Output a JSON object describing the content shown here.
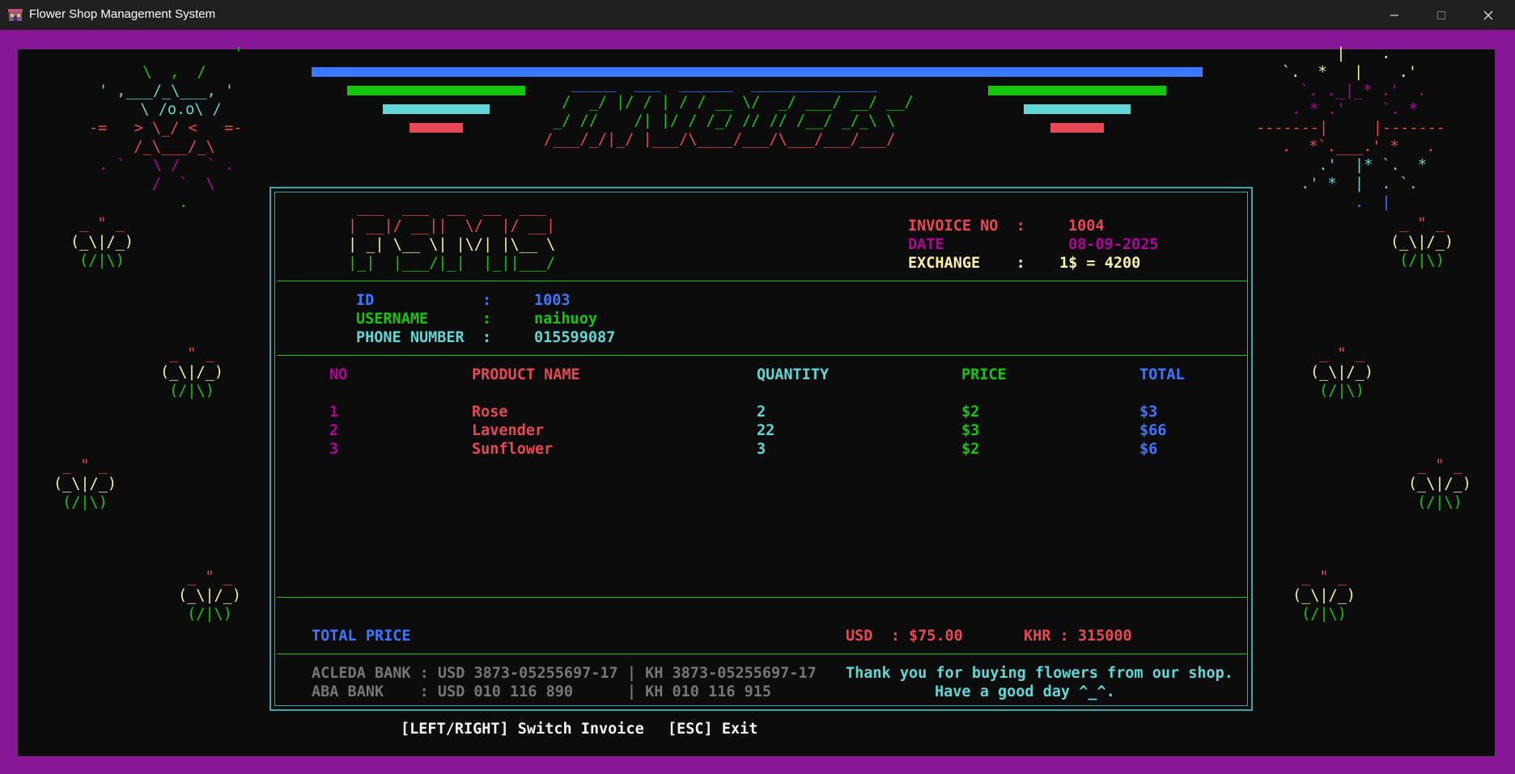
{
  "window": {
    "title": "Flower Shop Management System"
  },
  "art": {
    "fireworks_left": [
      "        '",
      "    \\  ,  /",
      "' ,___/_\\___, '",
      "   \\ /o.o\\ /",
      "-=   > \\_/ <   =-",
      "   /_\\___/_\\",
      ". `   \\ /   ` .",
      "     /  `  \\",
      "        ."
    ],
    "fireworks_right": [
      "          |    .",
      "`.  *   |    .'",
      "  `. ._|_* .'  .",
      ". * .'    `. *",
      "-------|     |-------",
      ".  *`.___.' *   .",
      "   .'  |* `.  *",
      " .' *  |  . `.",
      "       .  |"
    ],
    "flower": [
      " _ \" _",
      "(_\\|/_)",
      " (/|\\)"
    ],
    "invoice_banner": [
      "   _____  ___  ______  ______________",
      "  /  _/ |/ / | / / __ \\/  _/ ___/ __/ __/",
      " _/ //    /| |/ / /_/ // // /__/ _/_\\ \\",
      "/___/_/|_/ |___/\\____/___/\\___/___/___/"
    ],
    "fsms_logo": [
      " ___  ___  __  __  ___",
      "| __|/ __||  \\/  |/ __|",
      "| _| \\__ \\| |\\/| |\\__ \\",
      "|_|  |___/|_|  |_||___/"
    ]
  },
  "invoice": {
    "no_label": "INVOICE NO  :",
    "no_value": "1004",
    "date_label": "DATE",
    "date_value": "08-09-2025",
    "exchange_label": "EXCHANGE    :",
    "exchange_value": "1$ = 4200"
  },
  "customer": {
    "id_label": "ID            :",
    "id_value": "1003",
    "username_label": "USERNAME      :",
    "username_value": "naihuoy",
    "phone_label": "PHONE NUMBER  :",
    "phone_value": "015599087"
  },
  "table": {
    "headers": {
      "no": "NO",
      "name": "PRODUCT NAME",
      "qty": "QUANTITY",
      "price": "PRICE",
      "total": "TOTAL"
    },
    "rows": [
      {
        "no": "1",
        "name": "Rose",
        "qty": "2",
        "price": "$2",
        "total": "$3"
      },
      {
        "no": "2",
        "name": "Lavender",
        "qty": "22",
        "price": "$3",
        "total": "$66"
      },
      {
        "no": "3",
        "name": "Sunflower",
        "qty": "3",
        "price": "$2",
        "total": "$6"
      }
    ]
  },
  "totals": {
    "label": "TOTAL PRICE",
    "usd": "USD  : $75.00",
    "khr": "KHR : 315000"
  },
  "footer": {
    "bank1": "ACLEDA BANK : USD 3873-05255697-17 | KH 3873-05255697-17",
    "bank2": "ABA BANK    : USD 010 116 890      | KH 010 116 915",
    "thanks1": "Thank you for buying flowers from our shop.",
    "thanks2": "Have a good day ^_^."
  },
  "hints": {
    "switch": "[LEFT/RIGHT] Switch Invoice",
    "exit": "[ESC] Exit"
  },
  "colors": {
    "console_bg": "#0c0c0c",
    "frame": "#881798",
    "blue": "#3b78ff",
    "green": "#16c60c",
    "red": "#e74856",
    "cyan": "#61d6d6",
    "magenta": "#b4009e",
    "yellow": "#f9f1a5"
  }
}
